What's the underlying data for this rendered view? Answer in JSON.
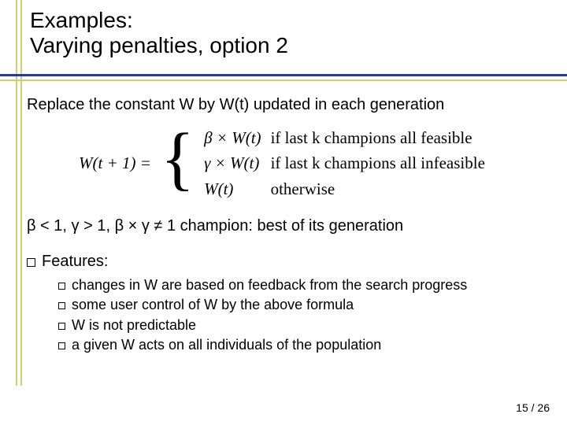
{
  "title_line1": "Examples:",
  "title_line2": "Varying penalties, option 2",
  "intro": "Replace the constant W by W(t) updated in each generation",
  "formula": {
    "lhs": "W(t + 1) =",
    "cases": [
      {
        "expr": "β × W(t)",
        "cond": "if last k champions all feasible"
      },
      {
        "expr": "γ × W(t)",
        "cond": "if last k champions all infeasible"
      },
      {
        "expr": "W(t)",
        "cond": "otherwise"
      }
    ]
  },
  "greek_line": "β < 1,  γ > 1,  β × γ ≠ 1   champion: best of its generation",
  "features_label": "Features:",
  "features": [
    "changes in W are based on feedback from the search progress",
    "some user control of W by the above formula",
    "W is not predictable",
    "a given W acts on all individuals of the population"
  ],
  "page": {
    "current": "15",
    "sep": " / ",
    "total": "26"
  }
}
